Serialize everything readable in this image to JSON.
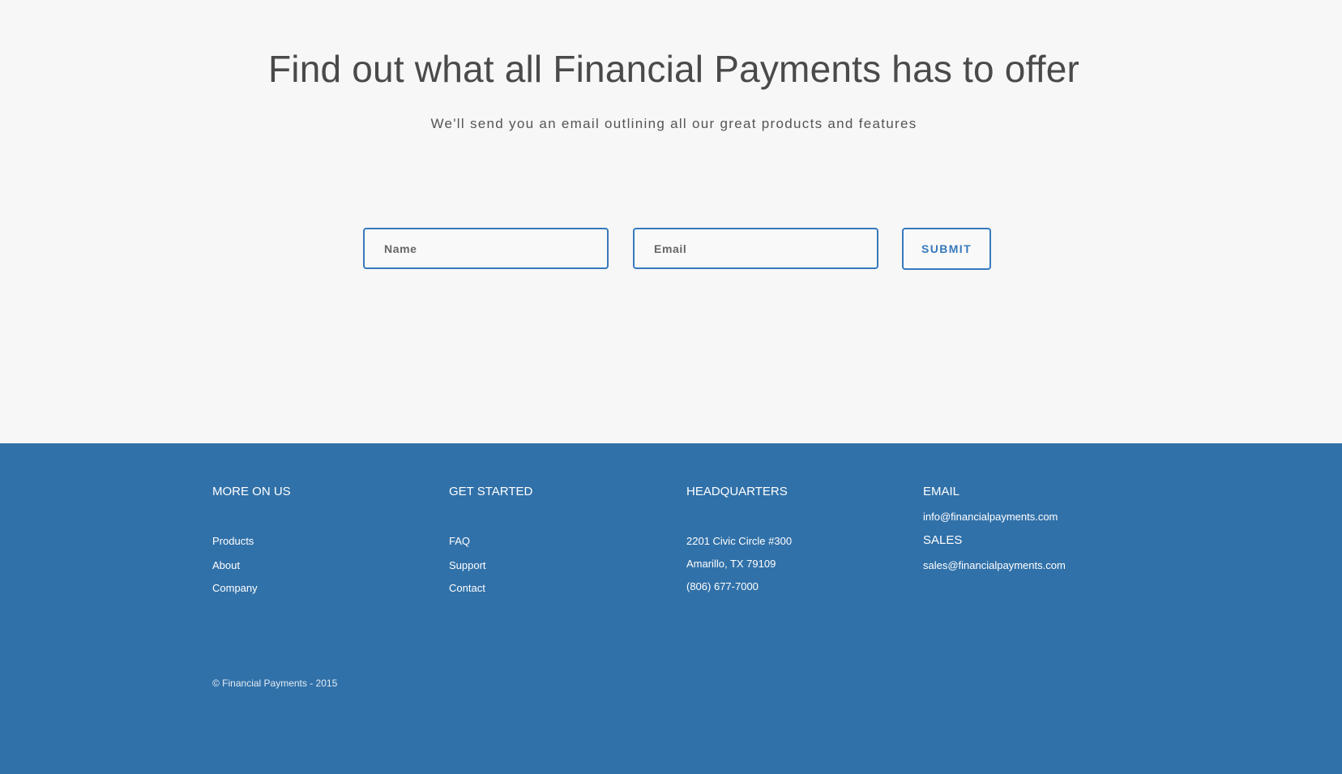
{
  "hero": {
    "title": "Find out what all Financial Payments has to offer",
    "subtitle": "We'll send you an email outlining all our great products and features"
  },
  "form": {
    "name_placeholder": "Name",
    "email_placeholder": "Email",
    "submit_label": "SUBMIT"
  },
  "footer": {
    "more_on_us": {
      "heading": "MORE ON US",
      "links": [
        "Products",
        "About",
        "Company"
      ]
    },
    "get_started": {
      "heading": "GET STARTED",
      "links": [
        "FAQ",
        "Support",
        "Contact"
      ]
    },
    "headquarters": {
      "heading": "HEADQUARTERS",
      "lines": [
        "2201 Civic Circle #300",
        "Amarillo, TX 79109",
        "(806) 677-7000"
      ]
    },
    "contact": {
      "email_heading": "EMAIL",
      "email": "info@financialpayments.com",
      "sales_heading": "SALES",
      "sales_email": "sales@financialpayments.com"
    },
    "copyright": "© Financial Payments - 2015"
  },
  "colors": {
    "accent": "#3779bd",
    "footer_bg": "#3171a9",
    "page_bg": "#f7f7f7"
  }
}
